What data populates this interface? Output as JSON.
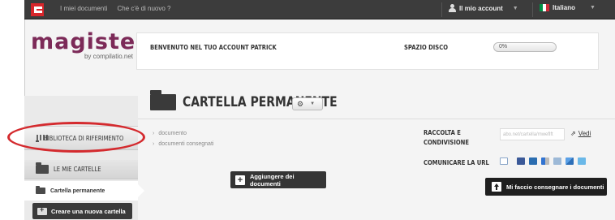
{
  "topbar": {
    "nav": [
      "I miei documenti",
      "Che c'è di nuovo ?"
    ],
    "account_label": "Il mio account",
    "language_label": "Italiano"
  },
  "brand": {
    "name": "magister",
    "sub": "by compilatio.net"
  },
  "welcome": {
    "message": "BENVENUTO NEL TUO ACCOUNT PATRICK",
    "disk_label": "SPAZIO DISCO",
    "disk_usage": "0%"
  },
  "sidebar": {
    "library": "BIBLIOTECA DI RIFERIMENTO",
    "my_folders": "LE MIE CARTELLE",
    "permanent_folder": "Cartella permanente",
    "new_folder_button": "Creare una nuova cartella"
  },
  "folder": {
    "title": "CARTELLA PERMANENTE",
    "documents": [
      "documento",
      "documenti consegnati"
    ],
    "add_documents_button": "Aggiungere dei documenti"
  },
  "sharing": {
    "collect_label_line1": "RACCOLTA E",
    "collect_label_line2": "CONDIVISIONE",
    "url_value": "abo.net/cartella/mweflft",
    "view_link": "Vedi",
    "communicate_label": "COMUNICARE LA URL",
    "deliver_button": "Mi faccio consegnare i documenti"
  },
  "colors": {
    "brand": "#7c2a58",
    "logo_red": "#d8262b",
    "highlight_oval": "#d42a2e",
    "flag_green": "#009246",
    "flag_white": "#ffffff",
    "flag_red": "#ce2b37"
  },
  "icons": {
    "social": [
      "mail-icon",
      "facebook-icon",
      "myspace-icon",
      "delicious-icon",
      "digg-icon",
      "live-icon",
      "twitter-icon"
    ]
  }
}
